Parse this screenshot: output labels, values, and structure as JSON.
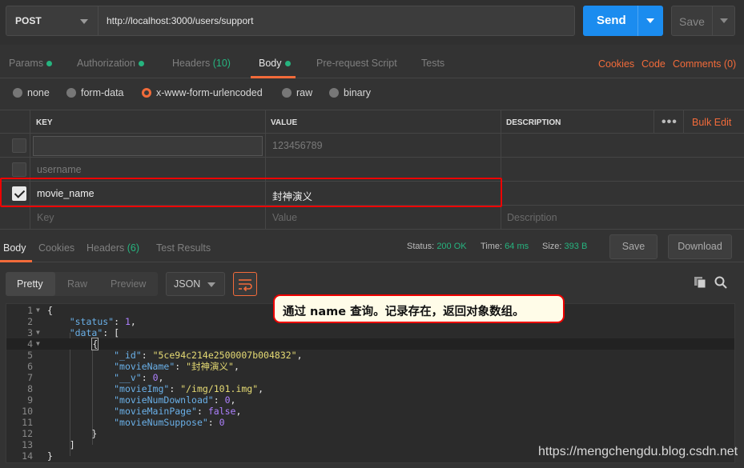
{
  "request": {
    "method": "POST",
    "url": "http://localhost:3000/users/support",
    "send_label": "Send",
    "save_label": "Save"
  },
  "request_tabs": [
    {
      "label": "Params"
    },
    {
      "label": "Authorization"
    },
    {
      "label": "Headers",
      "count": "(10)"
    },
    {
      "label": "Body"
    },
    {
      "label": "Pre-request Script"
    },
    {
      "label": "Tests"
    }
  ],
  "top_links": {
    "cookies": "Cookies",
    "code": "Code",
    "comments": "Comments (0)"
  },
  "body_types": [
    "none",
    "form-data",
    "x-www-form-urlencoded",
    "raw",
    "binary"
  ],
  "kv_table": {
    "headers": {
      "key": "KEY",
      "value": "VALUE",
      "description": "DESCRIPTION"
    },
    "bulk_edit": "Bulk Edit",
    "rows": [
      {
        "key": "",
        "value": "123456789",
        "description": ""
      },
      {
        "key": "username",
        "value": "",
        "description": ""
      },
      {
        "key": "movie_name",
        "value": "封神演义",
        "description": ""
      }
    ],
    "placeholders": {
      "key": "Key",
      "value": "Value",
      "description": "Description"
    }
  },
  "response_tabs": [
    {
      "label": "Body"
    },
    {
      "label": "Cookies"
    },
    {
      "label": "Headers",
      "count": "(6)"
    },
    {
      "label": "Test Results"
    }
  ],
  "response_status": {
    "status_label": "Status:",
    "status_value": "200 OK",
    "time_label": "Time:",
    "time_value": "64 ms",
    "size_label": "Size:",
    "size_value": "393 B"
  },
  "response_buttons": {
    "save": "Save",
    "download": "Download"
  },
  "view_modes": [
    "Pretty",
    "Raw",
    "Preview"
  ],
  "format": "JSON",
  "code": {
    "line_numbers": [
      "1",
      "2",
      "3",
      "4",
      "5",
      "6",
      "7",
      "8",
      "9",
      "10",
      "11",
      "12",
      "13",
      "14"
    ],
    "lines": {
      "l1": "{",
      "l2_key": "\"status\"",
      "l2_val": "1",
      "l3_key": "\"data\"",
      "l3_val": "[",
      "l4": "{",
      "l5_key": "\"_id\"",
      "l5_val": "\"5ce94c214e2500007b004832\"",
      "l6_key": "\"movieName\"",
      "l6_val": "\"封神演义\"",
      "l7_key": "\"__v\"",
      "l7_val": "0",
      "l8_key": "\"movieImg\"",
      "l8_val": "\"/img/101.img\"",
      "l9_key": "\"movieNumDownload\"",
      "l9_val": "0",
      "l10_key": "\"movieMainPage\"",
      "l10_val": "false",
      "l11_key": "\"movieNumSuppose\"",
      "l11_val": "0",
      "l12": "}",
      "l13": "]",
      "l14": "}"
    }
  },
  "annotation": "通过 name 查询。记录存在，返回对象数组。",
  "watermark": "https://mengchengdu.blog.csdn.net",
  "colors": {
    "accent": "#f26b3a",
    "send": "#1b8cef",
    "ok": "#26b47f",
    "highlight": "#ee0000"
  }
}
